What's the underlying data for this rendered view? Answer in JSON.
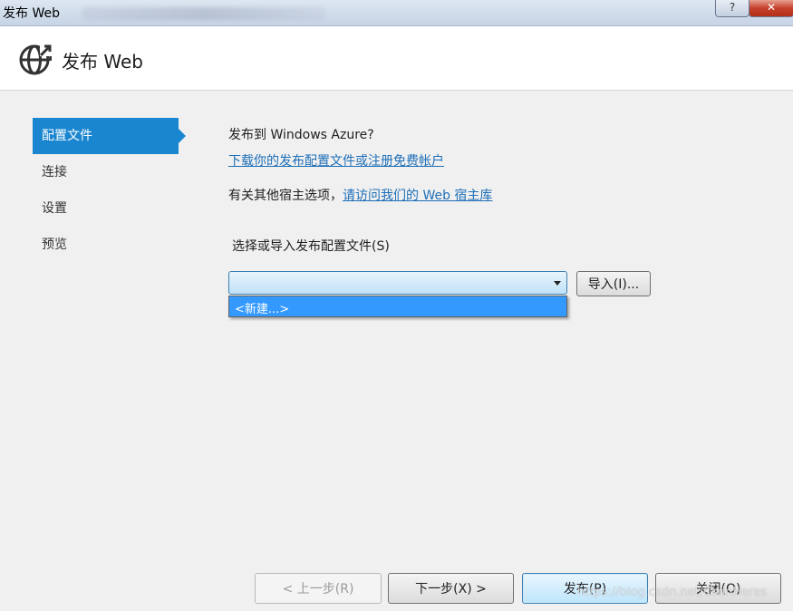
{
  "window": {
    "title": "发布 Web",
    "help_label": "?",
    "close_label": "✕"
  },
  "header": {
    "title": "发布 Web",
    "icon": "globe-publish-icon"
  },
  "nav": {
    "items": [
      {
        "label": "配置文件",
        "active": true
      },
      {
        "label": "连接",
        "active": false
      },
      {
        "label": "设置",
        "active": false
      },
      {
        "label": "预览",
        "active": false
      }
    ]
  },
  "main": {
    "question": "发布到 Windows Azure?",
    "download_link": "下载你的发布配置文件或注册免费帐户",
    "other_prefix": "有关其他宿主选项，",
    "other_link": "请访问我们的 Web 宿主库",
    "select_label": "选择或导入发布配置文件(S)",
    "combo_value": "",
    "dropdown_option": "<新建...>",
    "import_label": "导入(I)..."
  },
  "footer": {
    "back_label": "< 上一步(R)",
    "next_label": "下一步(X) >",
    "publish_label": "发布(P)",
    "close_label": "关闭(O)"
  },
  "watermark": "https://blog.csdn.net/CsdnHeres",
  "colors": {
    "accent": "#1a86d0",
    "link": "#1e6fb8",
    "selection": "#3399ff"
  }
}
